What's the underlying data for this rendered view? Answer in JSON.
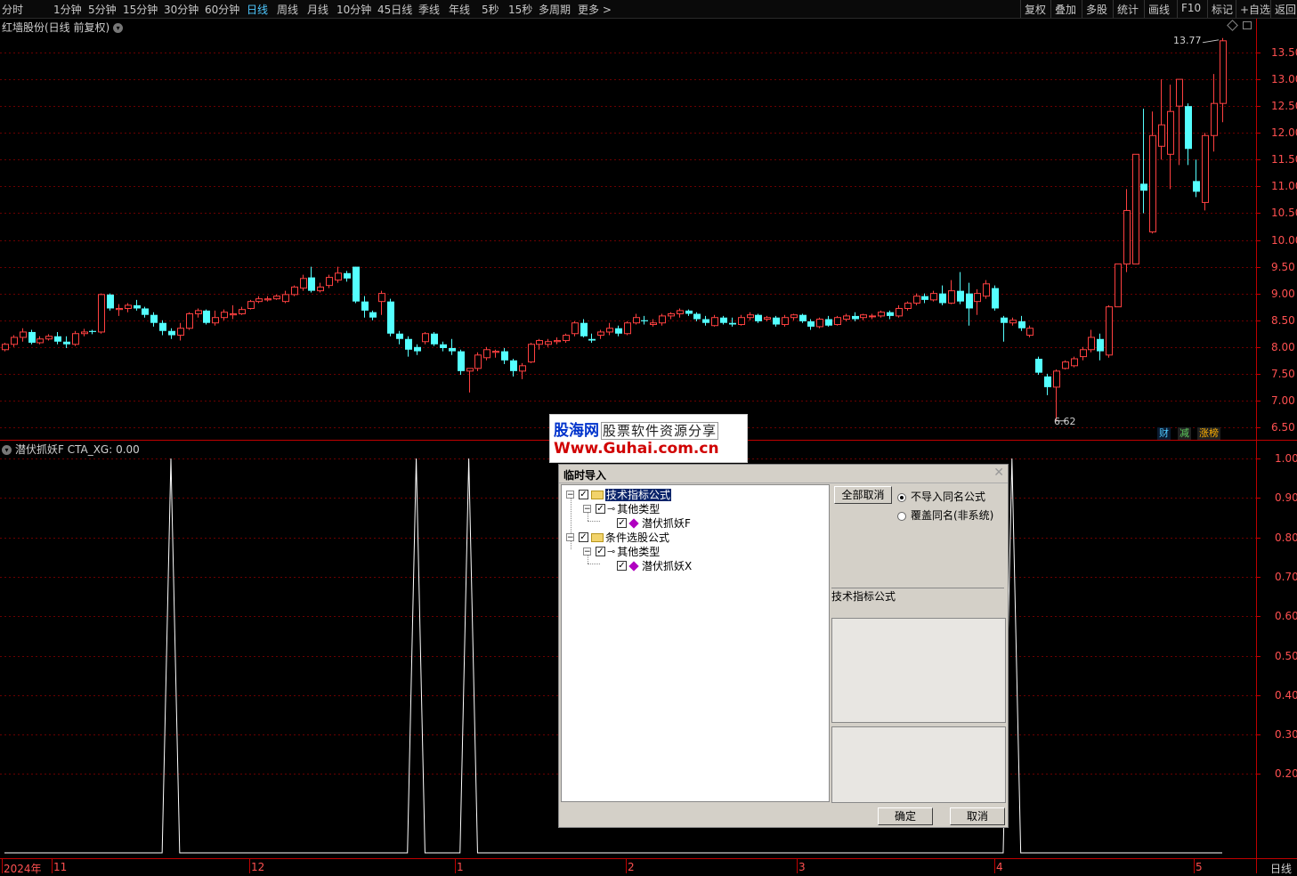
{
  "toolbar": {
    "periods": [
      "分时",
      "1分钟",
      "5分钟",
      "15分钟",
      "30分钟",
      "60分钟",
      "日线",
      "周线",
      "月线",
      "10分钟",
      "45日线",
      "季线",
      "年线",
      "5秒",
      "15秒",
      "多周期",
      "更多 >"
    ],
    "active_period": "日线",
    "right_tools": [
      "复权",
      "叠加",
      "多股",
      "统计",
      "画线",
      "F10",
      "标记",
      "+自选",
      "返回"
    ]
  },
  "stock": {
    "title": "红墙股份(日线 前复权)",
    "high_label": "13.77",
    "low_label": "6.62"
  },
  "price_axis": [
    "13.50",
    "13.00",
    "12.50",
    "12.00",
    "11.50",
    "11.00",
    "10.50",
    "10.00",
    "9.50",
    "9.00",
    "8.50",
    "8.00",
    "7.50",
    "7.00",
    "6.50"
  ],
  "indicator": {
    "title": "潜伏抓妖F  CTA_XG: 0.00",
    "axis": [
      "1.00",
      "0.90",
      "0.80",
      "0.70",
      "0.60",
      "0.50",
      "0.40",
      "0.30",
      "0.20"
    ],
    "signal_candles": [
      19,
      47,
      53,
      115
    ]
  },
  "date_axis": [
    "2024年",
    "11",
    "12",
    "1",
    "2",
    "3",
    "4",
    "5"
  ],
  "period_footer": "日线",
  "badges": {
    "cai": "财",
    "jz": "减",
    "zt": "涨榜"
  },
  "watermark": {
    "name": "股海网",
    "slogan": "股票软件资源分享",
    "url": "Www.Guhai.com.cn"
  },
  "dialog": {
    "title": "临时导入",
    "tree": {
      "root1": "技术指标公式",
      "child1": "其他类型",
      "leaf1": "潜伏抓妖F",
      "root2": "条件选股公式",
      "child2": "其他类型",
      "leaf2": "潜伏抓妖X"
    },
    "cancel_all": "全部取消",
    "radio1": "不导入同名公式",
    "radio2": "覆盖同名(非系统)",
    "selected_radio": "不导入同名公式",
    "desc_label": "技术指标公式",
    "ok": "确定",
    "cancel": "取消"
  },
  "colors": {
    "up": "#ff4040",
    "down": "#54ffff",
    "grid": "#6a0000",
    "axis": "#c00000",
    "signal": "#ffffff"
  },
  "chart_data": {
    "type": "candlestick",
    "price_range": [
      6.3,
      13.85
    ],
    "candles": [
      [
        7.95,
        8.05,
        8.08,
        7.92
      ],
      [
        8.05,
        8.18,
        8.22,
        8.0
      ],
      [
        8.18,
        8.28,
        8.35,
        8.1
      ],
      [
        8.28,
        8.08,
        8.32,
        8.05
      ],
      [
        8.08,
        8.15,
        8.2,
        8.05
      ],
      [
        8.15,
        8.2,
        8.24,
        8.12
      ],
      [
        8.2,
        8.1,
        8.28,
        8.05
      ],
      [
        8.1,
        8.05,
        8.2,
        7.98
      ],
      [
        8.05,
        8.25,
        8.3,
        8.02
      ],
      [
        8.25,
        8.28,
        8.34,
        8.2
      ],
      [
        8.3,
        8.28,
        8.32,
        8.24
      ],
      [
        8.28,
        8.98,
        9.0,
        8.25
      ],
      [
        8.98,
        8.72,
        9.0,
        8.68
      ],
      [
        8.7,
        8.72,
        8.8,
        8.58
      ],
      [
        8.72,
        8.78,
        8.82,
        8.65
      ],
      [
        8.78,
        8.72,
        8.88,
        8.68
      ],
      [
        8.72,
        8.6,
        8.75,
        8.55
      ],
      [
        8.6,
        8.45,
        8.65,
        8.38
      ],
      [
        8.45,
        8.3,
        8.5,
        8.22
      ],
      [
        8.3,
        8.22,
        8.35,
        8.15
      ],
      [
        8.22,
        8.35,
        8.45,
        8.12
      ],
      [
        8.35,
        8.62,
        8.65,
        8.32
      ],
      [
        8.62,
        8.68,
        8.72,
        8.55
      ],
      [
        8.68,
        8.45,
        8.7,
        8.42
      ],
      [
        8.45,
        8.55,
        8.68,
        8.4
      ],
      [
        8.55,
        8.65,
        8.7,
        8.5
      ],
      [
        8.6,
        8.62,
        8.78,
        8.52
      ],
      [
        8.62,
        8.7,
        8.75,
        8.6
      ],
      [
        8.72,
        8.85,
        8.88,
        8.7
      ],
      [
        8.85,
        8.9,
        8.95,
        8.82
      ],
      [
        8.88,
        8.9,
        8.95,
        8.85
      ],
      [
        8.9,
        8.95,
        8.98,
        8.88
      ],
      [
        8.85,
        8.98,
        9.05,
        8.82
      ],
      [
        8.98,
        9.12,
        9.15,
        8.95
      ],
      [
        9.1,
        9.28,
        9.35,
        9.05
      ],
      [
        9.3,
        9.05,
        9.5,
        9.02
      ],
      [
        9.05,
        9.12,
        9.2,
        9.02
      ],
      [
        9.15,
        9.3,
        9.35,
        9.1
      ],
      [
        9.25,
        9.38,
        9.5,
        9.2
      ],
      [
        9.38,
        9.28,
        9.42,
        9.22
      ],
      [
        9.5,
        8.85,
        9.5,
        8.82
      ],
      [
        8.85,
        8.68,
        8.95,
        8.55
      ],
      [
        8.65,
        8.55,
        8.68,
        8.5
      ],
      [
        8.85,
        9.0,
        9.05,
        8.6
      ],
      [
        8.85,
        8.25,
        8.9,
        8.2
      ],
      [
        8.25,
        8.15,
        8.3,
        8.05
      ],
      [
        8.15,
        7.95,
        8.2,
        7.82
      ],
      [
        8.0,
        7.92,
        8.05,
        7.85
      ],
      [
        8.1,
        8.25,
        8.28,
        8.05
      ],
      [
        8.25,
        8.05,
        8.28,
        8.02
      ],
      [
        8.05,
        7.98,
        8.1,
        7.92
      ],
      [
        7.98,
        7.92,
        8.15,
        7.85
      ],
      [
        7.92,
        7.55,
        7.95,
        7.48
      ],
      [
        7.55,
        7.6,
        7.6,
        7.15
      ],
      [
        7.6,
        7.85,
        7.9,
        7.55
      ],
      [
        7.8,
        7.95,
        8.0,
        7.75
      ],
      [
        7.9,
        7.92,
        7.95,
        7.8
      ],
      [
        7.92,
        7.75,
        7.98,
        7.68
      ],
      [
        7.75,
        7.55,
        7.78,
        7.45
      ],
      [
        7.55,
        7.65,
        7.7,
        7.4
      ],
      [
        7.72,
        8.05,
        8.08,
        7.7
      ],
      [
        8.05,
        8.12,
        8.15,
        7.95
      ],
      [
        8.05,
        8.1,
        8.15,
        8.0
      ],
      [
        8.1,
        8.12,
        8.18,
        8.05
      ],
      [
        8.12,
        8.22,
        8.25,
        8.08
      ],
      [
        8.25,
        8.45,
        8.48,
        8.2
      ],
      [
        8.45,
        8.2,
        8.52,
        8.18
      ],
      [
        8.15,
        8.12,
        8.25,
        8.08
      ],
      [
        8.22,
        8.28,
        8.32,
        8.15
      ],
      [
        8.28,
        8.35,
        8.45,
        8.22
      ],
      [
        8.35,
        8.25,
        8.4,
        8.2
      ],
      [
        8.25,
        8.45,
        8.48,
        8.22
      ],
      [
        8.45,
        8.55,
        8.62,
        8.42
      ],
      [
        8.5,
        8.48,
        8.58,
        8.42
      ],
      [
        8.42,
        8.45,
        8.52,
        8.38
      ],
      [
        8.45,
        8.58,
        8.62,
        8.4
      ],
      [
        8.58,
        8.62,
        8.65,
        8.52
      ],
      [
        8.62,
        8.68,
        8.72,
        8.55
      ],
      [
        8.68,
        8.62,
        8.7,
        8.58
      ],
      [
        8.62,
        8.52,
        8.65,
        8.48
      ],
      [
        8.52,
        8.45,
        8.58,
        8.4
      ],
      [
        8.4,
        8.55,
        8.6,
        8.38
      ],
      [
        8.55,
        8.45,
        8.58,
        8.42
      ],
      [
        8.45,
        8.42,
        8.55,
        8.38
      ],
      [
        8.42,
        8.55,
        8.6,
        8.4
      ],
      [
        8.55,
        8.6,
        8.65,
        8.5
      ],
      [
        8.6,
        8.48,
        8.62,
        8.45
      ],
      [
        8.52,
        8.55,
        8.58,
        8.48
      ],
      [
        8.55,
        8.42,
        8.58,
        8.38
      ],
      [
        8.42,
        8.55,
        8.6,
        8.38
      ],
      [
        8.55,
        8.6,
        8.62,
        8.5
      ],
      [
        8.6,
        8.48,
        8.62,
        8.45
      ],
      [
        8.48,
        8.38,
        8.52,
        8.32
      ],
      [
        8.38,
        8.52,
        8.55,
        8.35
      ],
      [
        8.52,
        8.4,
        8.58,
        8.38
      ],
      [
        8.42,
        8.55,
        8.58,
        8.4
      ],
      [
        8.52,
        8.58,
        8.62,
        8.48
      ],
      [
        8.58,
        8.52,
        8.65,
        8.48
      ],
      [
        8.55,
        8.6,
        8.62,
        8.5
      ],
      [
        8.58,
        8.58,
        8.62,
        8.52
      ],
      [
        8.58,
        8.65,
        8.68,
        8.55
      ],
      [
        8.65,
        8.58,
        8.68,
        8.52
      ],
      [
        8.58,
        8.72,
        8.78,
        8.55
      ],
      [
        8.72,
        8.82,
        8.85,
        8.68
      ],
      [
        8.82,
        8.95,
        9.0,
        8.78
      ],
      [
        8.95,
        8.88,
        9.0,
        8.82
      ],
      [
        8.88,
        9.0,
        9.05,
        8.85
      ],
      [
        9.0,
        8.82,
        9.15,
        8.78
      ],
      [
        8.82,
        9.05,
        9.25,
        8.8
      ],
      [
        9.05,
        8.85,
        9.4,
        8.8
      ],
      [
        9.0,
        8.72,
        9.2,
        8.4
      ],
      [
        8.85,
        9.0,
        9.08,
        8.6
      ],
      [
        8.95,
        9.18,
        9.25,
        8.9
      ],
      [
        9.1,
        8.72,
        9.15,
        8.68
      ],
      [
        8.55,
        8.45,
        8.58,
        8.1
      ],
      [
        8.45,
        8.5,
        8.55,
        8.4
      ],
      [
        8.48,
        8.35,
        8.58,
        8.3
      ],
      [
        8.22,
        8.35,
        8.4,
        8.18
      ],
      [
        7.78,
        7.52,
        7.82,
        7.48
      ],
      [
        7.45,
        7.25,
        7.5,
        7.1
      ],
      [
        7.25,
        7.55,
        7.58,
        6.62
      ],
      [
        7.6,
        7.72,
        7.75,
        7.58
      ],
      [
        7.65,
        7.78,
        7.82,
        7.62
      ],
      [
        7.82,
        7.95,
        8.0,
        7.75
      ],
      [
        7.95,
        8.18,
        8.32,
        7.9
      ],
      [
        8.15,
        7.92,
        8.25,
        7.75
      ],
      [
        7.85,
        8.75,
        8.78,
        7.8
      ],
      [
        8.75,
        9.55,
        9.55,
        9.05
      ],
      [
        9.55,
        10.55,
        10.95,
        9.4
      ],
      [
        9.55,
        11.6,
        11.6,
        9.55
      ],
      [
        11.05,
        10.92,
        12.45,
        10.5
      ],
      [
        10.15,
        11.95,
        12.4,
        10.12
      ],
      [
        11.75,
        12.15,
        13.0,
        11.5
      ],
      [
        11.6,
        12.4,
        12.9,
        10.95
      ],
      [
        12.5,
        13.0,
        13.0,
        11.4
      ],
      [
        12.5,
        11.7,
        12.55,
        11.4
      ],
      [
        11.1,
        10.9,
        11.5,
        10.8
      ],
      [
        10.7,
        11.95,
        12.0,
        10.55
      ],
      [
        11.95,
        12.55,
        13.1,
        11.65
      ],
      [
        12.55,
        13.72,
        13.77,
        12.2
      ]
    ]
  }
}
